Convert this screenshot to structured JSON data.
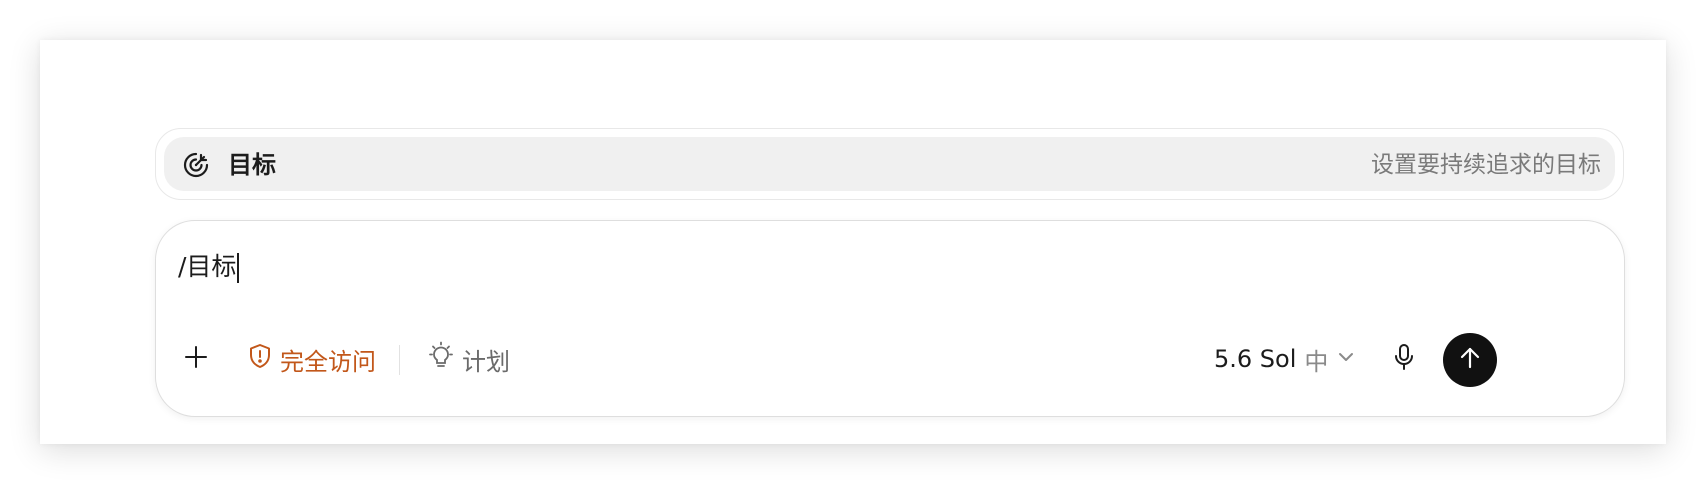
{
  "suggestion": {
    "icon": "goal-target-icon",
    "label": "目标",
    "description": "设置要持续追求的目标"
  },
  "composer": {
    "text": "/目标"
  },
  "toolbar": {
    "add_icon": "plus-icon",
    "access_icon": "shield-alert-icon",
    "access_label": "完全访问",
    "access_color": "#c2571a",
    "plan_icon": "lightbulb-icon",
    "plan_label": "计划",
    "model_name": "5.6 Sol",
    "model_level": "中",
    "model_dropdown_icon": "chevron-down-icon",
    "mic_icon": "microphone-icon",
    "send_icon": "arrow-up-icon",
    "send_color": "#111111"
  }
}
